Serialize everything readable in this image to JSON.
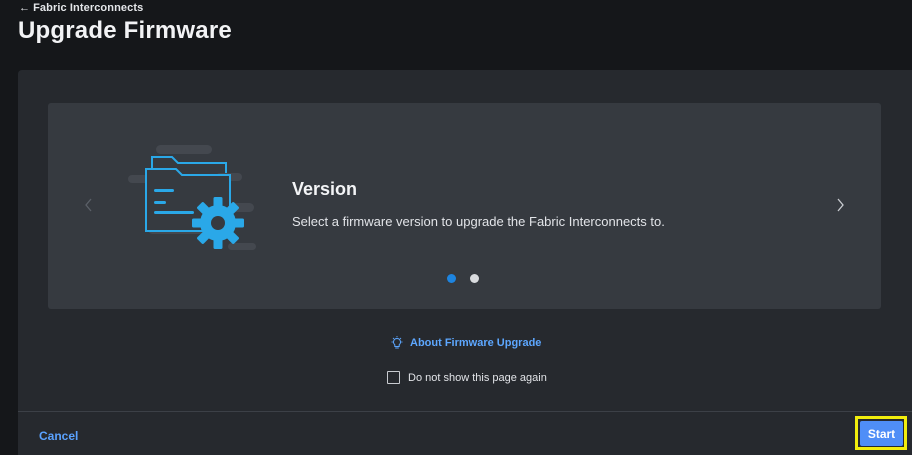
{
  "header": {
    "back_label": "Fabric Interconnects",
    "title": "Upgrade Firmware"
  },
  "carousel": {
    "slide_title": "Version",
    "slide_description": "Select a firmware version to upgrade the Fabric Interconnects to.",
    "active_slide": 1,
    "slide_count": 2,
    "illustration_icon": "folder-gear-icon"
  },
  "help": {
    "about_label": "About Firmware Upgrade",
    "icon": "lightbulb-icon"
  },
  "options": {
    "dont_show_label": "Do not show this page again",
    "dont_show_checked": false
  },
  "footer": {
    "cancel_label": "Cancel",
    "start_label": "Start"
  },
  "colors": {
    "accent": "#4f8ef7",
    "link": "#5da7ff",
    "active_dot": "#1d84e0",
    "illustration": "#2aa8e8",
    "highlight": "#f2ee0d"
  }
}
